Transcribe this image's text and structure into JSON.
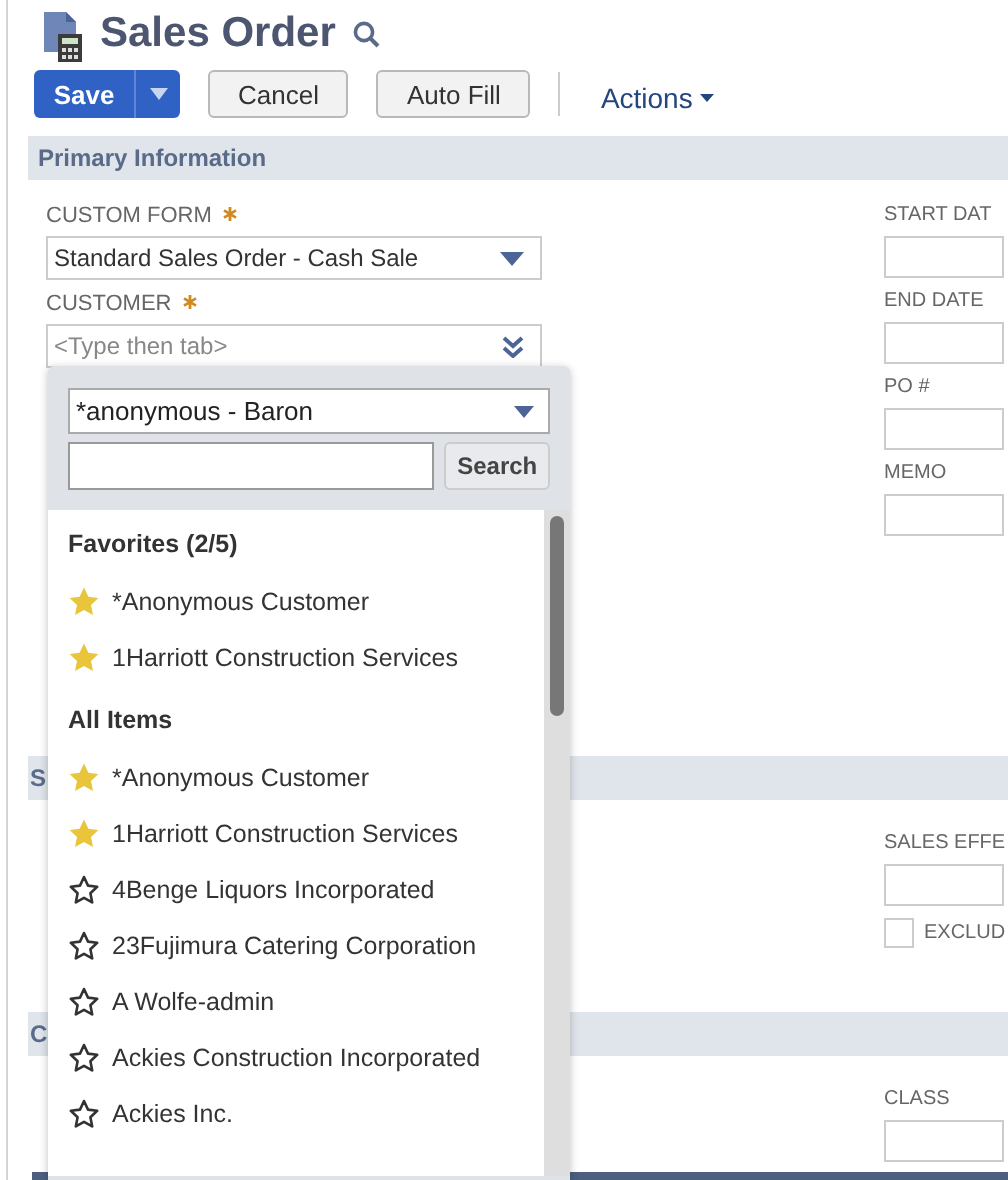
{
  "title": "Sales Order",
  "toolbar": {
    "save": "Save",
    "cancel": "Cancel",
    "auto_fill": "Auto Fill",
    "actions": "Actions"
  },
  "sections": [
    {
      "title": "Primary Information",
      "left_fields": [
        {
          "label": "CUSTOM FORM",
          "required": true,
          "kind": "select",
          "value": "Standard Sales Order - Cash Sale"
        },
        {
          "label": "CUSTOMER",
          "required": true,
          "kind": "lookup",
          "placeholder": "<Type then tab>"
        }
      ],
      "right_fields": [
        {
          "label": "START DAT",
          "kind": "text"
        },
        {
          "label": "END DATE",
          "kind": "text"
        },
        {
          "label": "PO #",
          "kind": "text"
        },
        {
          "label": "MEMO",
          "kind": "text"
        }
      ]
    },
    {
      "title": "S",
      "right_fields": [
        {
          "label": "SALES EFFE",
          "kind": "text"
        },
        {
          "label": "EXCLUD",
          "kind": "checkbox",
          "checked": false
        }
      ]
    },
    {
      "title": "C",
      "right_fields": [
        {
          "label": "CLASS",
          "kind": "text"
        }
      ]
    }
  ],
  "dropdown": {
    "select_value": "*anonymous - Baron",
    "search_button": "Search",
    "groups": [
      {
        "heading": "Favorites (2/5)",
        "items": [
          {
            "name": "*Anonymous Customer",
            "favorite": true
          },
          {
            "name": "1Harriott Construction Services",
            "favorite": true
          }
        ]
      },
      {
        "heading": "All Items",
        "items": [
          {
            "name": "*Anonymous Customer",
            "favorite": true
          },
          {
            "name": "1Harriott Construction Services",
            "favorite": true
          },
          {
            "name": "4Benge Liquors Incorporated",
            "favorite": false
          },
          {
            "name": "23Fujimura Catering Corporation",
            "favorite": false
          },
          {
            "name": "A Wolfe-admin",
            "favorite": false
          },
          {
            "name": "Ackies Construction Incorporated",
            "favorite": false
          },
          {
            "name": "Ackies Inc.",
            "favorite": false
          }
        ]
      }
    ]
  }
}
